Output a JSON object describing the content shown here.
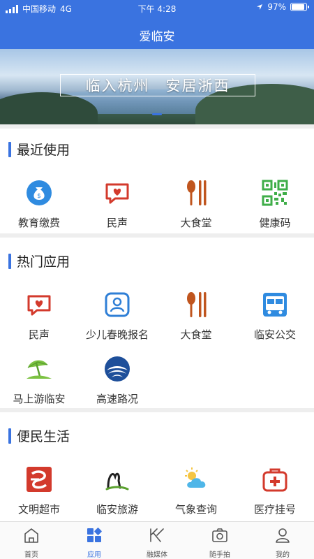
{
  "status_bar": {
    "carrier": "中国移动",
    "network": "4G",
    "time": "下午 4:28",
    "battery": "97%",
    "battery_level": 0.97
  },
  "app": {
    "title": "爱临安"
  },
  "banner": {
    "slogan": "临入杭州　安居浙西"
  },
  "sections": {
    "recent": {
      "title": "最近使用",
      "items": [
        {
          "label": "教育缴费",
          "icon": "money-bag-icon"
        },
        {
          "label": "民声",
          "icon": "chat-heart-icon"
        },
        {
          "label": "大食堂",
          "icon": "spoon-chopsticks-icon"
        },
        {
          "label": "健康码",
          "icon": "qr-code-icon"
        }
      ]
    },
    "hot": {
      "title": "热门应用",
      "items": [
        {
          "label": "民声",
          "icon": "chat-heart-icon"
        },
        {
          "label": "少儿春晚报名",
          "icon": "person-badge-icon"
        },
        {
          "label": "大食堂",
          "icon": "spoon-chopsticks-icon"
        },
        {
          "label": "临安公交",
          "icon": "bus-icon"
        },
        {
          "label": "马上游临安",
          "icon": "beach-umbrella-icon"
        },
        {
          "label": "高速路况",
          "icon": "highway-logo-icon"
        }
      ]
    },
    "life": {
      "title": "便民生活",
      "items": [
        {
          "label": "文明超市",
          "icon": "supermarket-logo-icon"
        },
        {
          "label": "临安旅游",
          "icon": "tourism-logo-icon"
        },
        {
          "label": "气象查询",
          "icon": "weather-icon"
        },
        {
          "label": "医疗挂号",
          "icon": "medical-kit-icon"
        }
      ]
    }
  },
  "bottom_nav": {
    "active": "应用",
    "tabs": [
      {
        "label": "首页",
        "icon": "home-icon"
      },
      {
        "label": "应用",
        "icon": "apps-icon"
      },
      {
        "label": "融媒体",
        "icon": "media-icon"
      },
      {
        "label": "随手拍",
        "icon": "camera-icon"
      },
      {
        "label": "我的",
        "icon": "profile-icon"
      }
    ]
  },
  "colors": {
    "primary": "#3a73e0",
    "icon_blue": "#2f7fd6",
    "icon_red": "#d33a2c",
    "icon_brown": "#c0551e",
    "icon_green": "#4caf50"
  }
}
